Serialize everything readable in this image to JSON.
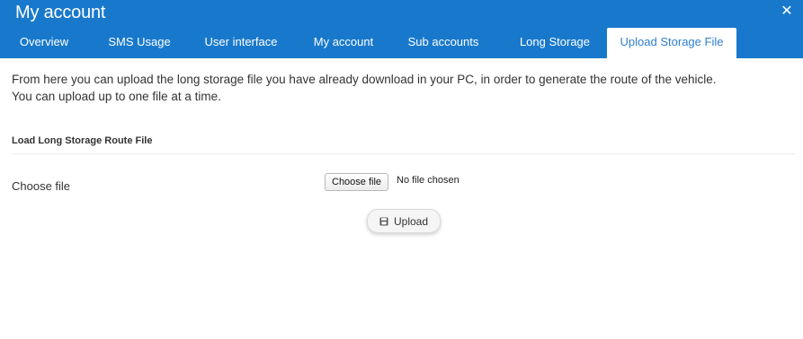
{
  "header": {
    "title": "My account",
    "close_glyph": "✕",
    "background_color": "#1879cc"
  },
  "tabs": [
    {
      "label": "Overview"
    },
    {
      "label": "SMS Usage"
    },
    {
      "label": "User interface"
    },
    {
      "label": "My account"
    },
    {
      "label": "Sub accounts"
    },
    {
      "label": "Long Storage"
    },
    {
      "label": "Upload Storage File",
      "active": true
    }
  ],
  "content": {
    "intro_line1": "From here you can upload the long storage file you have already download in your PC, in order to generate the route of the vehicle.",
    "intro_line2": "You can upload up to one file at a time.",
    "section_title": "Load Long Storage Route File",
    "field_label": "Choose file",
    "file_button_label": "Choose file",
    "file_status": "No file chosen",
    "upload_label": "Upload",
    "upload_icon": "floppy-disk-icon"
  }
}
